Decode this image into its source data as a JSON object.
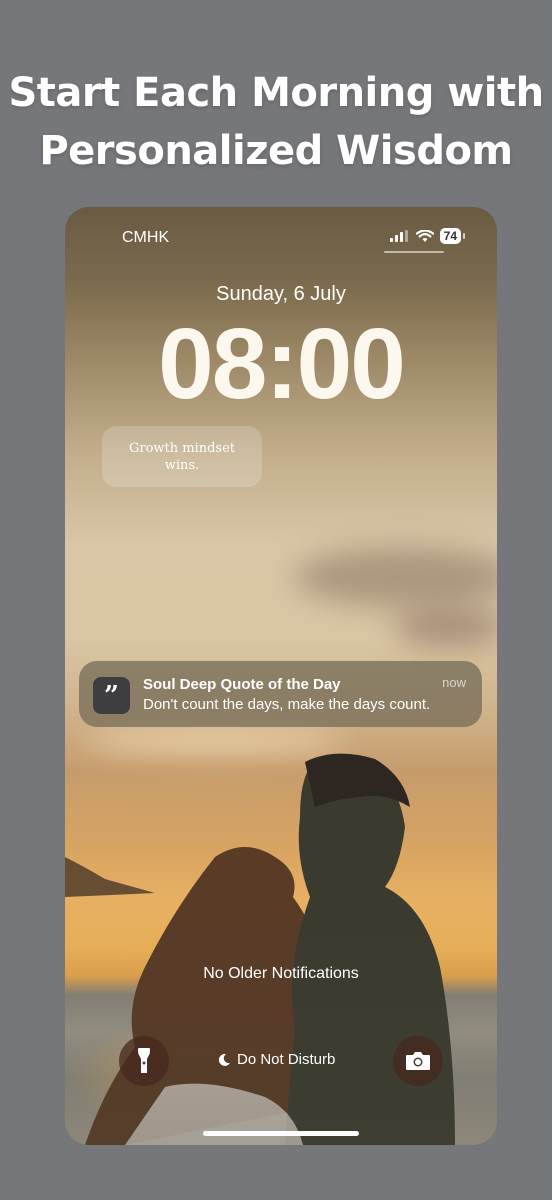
{
  "headline": {
    "line1": "Start Each Morning with",
    "line2": "Personalized Wisdom"
  },
  "status_bar": {
    "carrier": "CMHK",
    "battery": "74",
    "icons": [
      "signal-bars-icon",
      "wifi-icon",
      "battery-icon"
    ]
  },
  "lock_screen": {
    "date": "Sunday, 6 July",
    "time": "08:00",
    "widget_text": "Growth mindset wins."
  },
  "notification": {
    "app_icon": "quote-icon",
    "title": "Soul Deep Quote of the Day",
    "body": "Don't count the days, make the days count.",
    "time": "now"
  },
  "bottom": {
    "no_older": "No Older Notifications",
    "dnd_label": "Do Not Disturb",
    "left_button_icon": "flashlight-icon",
    "right_button_icon": "camera-icon",
    "dnd_icon": "moon-icon"
  },
  "colors": {
    "background": "#76777b",
    "notification_bg": "#786e5a"
  }
}
